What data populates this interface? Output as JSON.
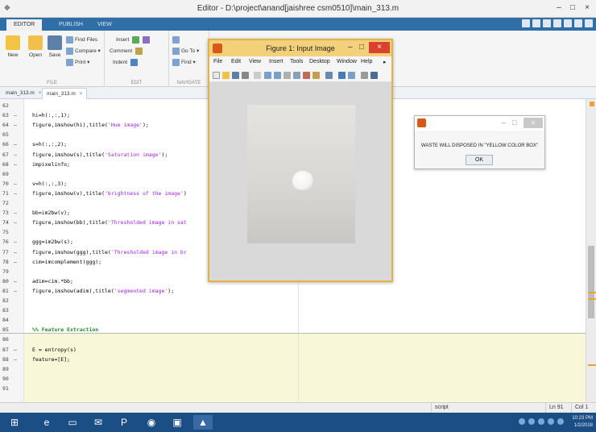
{
  "window": {
    "title": "Editor - D:\\project\\anand[jaishree csm0510]\\main_313.m",
    "minimize": "–",
    "maximize": "□",
    "close": "×"
  },
  "ribbon_tabs": [
    {
      "label": "EDITOR",
      "active": true
    },
    {
      "label": "PUBLISH",
      "active": false
    },
    {
      "label": "VIEW",
      "active": false
    }
  ],
  "toolstrip": {
    "file": {
      "new": "New",
      "open": "Open",
      "save": "Save",
      "find_files": "Find Files",
      "compare": "Compare ▾",
      "print": "Print ▾",
      "group_label": "FILE"
    },
    "edit": {
      "insert": "Insert",
      "comment": "Comment",
      "indent": "Indent",
      "group_label": "EDIT"
    },
    "navigate": {
      "go_to": "Go To ▾",
      "find": "Find ▾",
      "group_label": "NAVIGATE"
    }
  },
  "file_tabs": [
    {
      "label": "main_313.m",
      "close": "×",
      "active": false
    },
    {
      "label": "main_313.m",
      "close": "×",
      "active": true
    }
  ],
  "code_lines": [
    {
      "num": "62",
      "dash": "",
      "parts": []
    },
    {
      "num": "63",
      "dash": "–",
      "parts": [
        {
          "t": "hi=h(:,:,1);",
          "c": "plain"
        }
      ]
    },
    {
      "num": "64",
      "dash": "–",
      "parts": [
        {
          "t": "figure,imshow(hi),title(",
          "c": "plain"
        },
        {
          "t": "'Hue image'",
          "c": "str"
        },
        {
          "t": ");",
          "c": "plain"
        }
      ]
    },
    {
      "num": "65",
      "dash": "",
      "parts": []
    },
    {
      "num": "66",
      "dash": "–",
      "parts": [
        {
          "t": "s=h(:,:,2);",
          "c": "plain"
        }
      ]
    },
    {
      "num": "67",
      "dash": "–",
      "parts": [
        {
          "t": "figure,imshow(s),title(",
          "c": "plain"
        },
        {
          "t": "'Saturation image'",
          "c": "str"
        },
        {
          "t": ");",
          "c": "plain"
        }
      ]
    },
    {
      "num": "68",
      "dash": "–",
      "parts": [
        {
          "t": "impixelinfo;",
          "c": "plain"
        }
      ]
    },
    {
      "num": "69",
      "dash": "",
      "parts": []
    },
    {
      "num": "70",
      "dash": "–",
      "parts": [
        {
          "t": "v=h(:,:,3);",
          "c": "plain"
        }
      ]
    },
    {
      "num": "71",
      "dash": "–",
      "parts": [
        {
          "t": "figure,imshow(v),title(",
          "c": "plain"
        },
        {
          "t": "'brightness of the image'",
          "c": "str"
        },
        {
          "t": ")",
          "c": "plain"
        }
      ]
    },
    {
      "num": "72",
      "dash": "",
      "parts": []
    },
    {
      "num": "73",
      "dash": "–",
      "parts": [
        {
          "t": "bb=im2bw(v);",
          "c": "plain"
        }
      ]
    },
    {
      "num": "74",
      "dash": "–",
      "parts": [
        {
          "t": "figure,imshow(bb),title(",
          "c": "plain"
        },
        {
          "t": "'Thresholded image in sat",
          "c": "str"
        }
      ]
    },
    {
      "num": "75",
      "dash": "",
      "parts": []
    },
    {
      "num": "76",
      "dash": "–",
      "parts": [
        {
          "t": "ggg=im2bw(s);",
          "c": "plain"
        }
      ]
    },
    {
      "num": "77",
      "dash": "–",
      "parts": [
        {
          "t": "figure,imshow(ggg),title(",
          "c": "plain"
        },
        {
          "t": "'Thresholded image in br",
          "c": "str"
        }
      ]
    },
    {
      "num": "78",
      "dash": "–",
      "parts": [
        {
          "t": "cim=imcomplement(ggg);",
          "c": "plain"
        }
      ]
    },
    {
      "num": "79",
      "dash": "",
      "parts": []
    },
    {
      "num": "80",
      "dash": "–",
      "parts": [
        {
          "t": "adim=cim.*bb;",
          "c": "plain"
        }
      ]
    },
    {
      "num": "81",
      "dash": "–",
      "parts": [
        {
          "t": "figure,imshow(adim),title(",
          "c": "plain"
        },
        {
          "t": "'segmented image'",
          "c": "str"
        },
        {
          "t": ");",
          "c": "plain"
        }
      ]
    },
    {
      "num": "82",
      "dash": "",
      "parts": []
    },
    {
      "num": "83",
      "dash": "",
      "parts": []
    },
    {
      "num": "84",
      "dash": "",
      "parts": []
    },
    {
      "num": "85",
      "dash": "",
      "parts": [
        {
          "t": "%% Feature Extraction",
          "c": "comment"
        }
      ]
    },
    {
      "num": "86",
      "dash": "",
      "parts": []
    },
    {
      "num": "87",
      "dash": "–",
      "parts": [
        {
          "t": "E = entropy(s)",
          "c": "plain"
        }
      ]
    },
    {
      "num": "88",
      "dash": "–",
      "parts": [
        {
          "t": "feature=[E];",
          "c": "plain"
        }
      ]
    },
    {
      "num": "89",
      "dash": "",
      "parts": []
    },
    {
      "num": "90",
      "dash": "",
      "parts": []
    },
    {
      "num": "91",
      "dash": "",
      "parts": []
    }
  ],
  "figure": {
    "title": "Figure 1: Input Image",
    "minimize": "–",
    "maximize": "□",
    "close": "×",
    "menu": [
      "File",
      "Edit",
      "View",
      "Insert",
      "Tools",
      "Desktop",
      "Window",
      "Help"
    ],
    "menu_arrow": "▸"
  },
  "dialog": {
    "minimize": "–",
    "maximize": "□",
    "close": "×",
    "message": "WASTE WILL DISPOSED IN \"YELLOW COLOR BOX\"",
    "ok": "OK"
  },
  "statusbar": {
    "mode": "script",
    "line": "Ln  91",
    "col": "Col  1"
  },
  "taskbar": {
    "time": "10:23 PM",
    "date": "1/2/2018",
    "apps": [
      "start-icon",
      "ie-icon",
      "explorer-icon",
      "outlook-icon",
      "powerpoint-icon",
      "chrome-icon",
      "monitor-icon",
      "matlab-icon"
    ]
  },
  "colors": {
    "figure_border": "#e0b34a",
    "tab_strip": "#2f6fa6",
    "taskbar": "#1c4e86",
    "string": "#a020f0",
    "comment": "#228b22"
  }
}
